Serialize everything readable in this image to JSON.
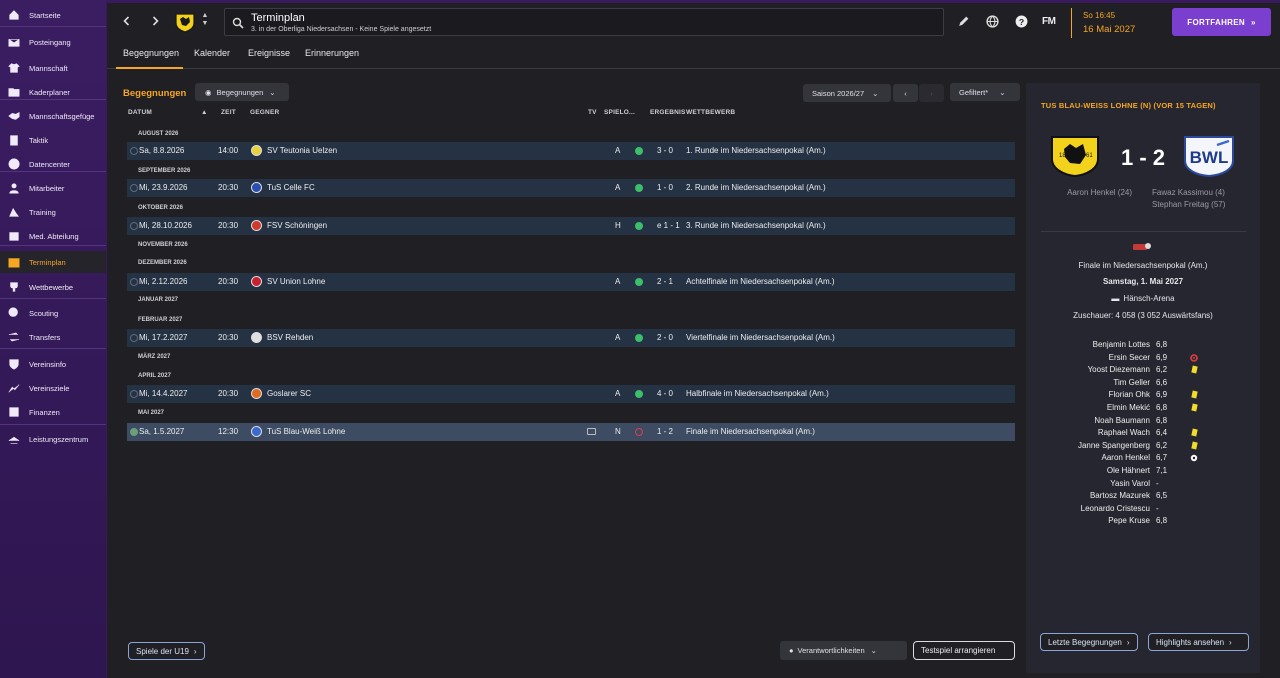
{
  "sidebar": {
    "items": [
      {
        "label": "Startseite",
        "icon": "home-icon"
      },
      {
        "label": "Posteingang",
        "icon": "inbox-icon"
      },
      {
        "label": "Mannschaft",
        "icon": "shirt-icon"
      },
      {
        "label": "Kaderplaner",
        "icon": "folder-icon"
      },
      {
        "label": "Mannschaftsgefüge",
        "icon": "handshake-icon"
      },
      {
        "label": "Taktik",
        "icon": "clipboard-icon"
      },
      {
        "label": "Datencenter",
        "icon": "data-icon"
      },
      {
        "label": "Mitarbeiter",
        "icon": "staff-icon"
      },
      {
        "label": "Training",
        "icon": "training-icon"
      },
      {
        "label": "Med. Abteilung",
        "icon": "medical-icon"
      },
      {
        "label": "Terminplan",
        "icon": "calendar-icon"
      },
      {
        "label": "Wettbewerbe",
        "icon": "trophy-icon"
      },
      {
        "label": "Scouting",
        "icon": "scouting-icon"
      },
      {
        "label": "Transfers",
        "icon": "transfers-icon"
      },
      {
        "label": "Vereinsinfo",
        "icon": "shield-icon"
      },
      {
        "label": "Vereinsziele",
        "icon": "goals-icon"
      },
      {
        "label": "Finanzen",
        "icon": "finance-icon"
      },
      {
        "label": "Leistungszentrum",
        "icon": "academy-icon"
      }
    ],
    "active": "Terminplan"
  },
  "header": {
    "title": "Terminplan",
    "subtitle": "3. in der Oberliga Niedersachsen - Keine Spiele angesetzt",
    "fm_label": "FM",
    "time": "So 16:45",
    "date": "16 Mai 2027",
    "continue_label": "FORTFAHREN"
  },
  "tabs": [
    "Begegnungen",
    "Kalender",
    "Ereignisse",
    "Erinnerungen"
  ],
  "section": {
    "title": "Begegnungen",
    "view_dropdown": "Begegnungen",
    "season": "Saison 2026/27",
    "filter": "Gefiltert*"
  },
  "table": {
    "columns": {
      "date": "DATUM",
      "time": "ZEIT",
      "opponent": "GEGNER",
      "tv": "TV",
      "venue": "SPIELO...",
      "result": "ERGEBNIS",
      "competition": "WETTBEWERB"
    },
    "rows": [
      {
        "type": "month",
        "label": "AUGUST 2026"
      },
      {
        "type": "match",
        "date": "Sa, 8.8.2026",
        "time": "14:00",
        "opponent": "SV Teutonia Uelzen",
        "venue": "A",
        "result": "3 - 0",
        "outcome": "win",
        "competition": "1. Runde im Niedersachsenpokal (Am.)",
        "badge_color": "#e8d23a"
      },
      {
        "type": "month",
        "label": "SEPTEMBER 2026"
      },
      {
        "type": "match",
        "date": "Mi, 23.9.2026",
        "time": "20:30",
        "opponent": "TuS Celle FC",
        "venue": "A",
        "result": "1 - 0",
        "outcome": "win",
        "competition": "2. Runde im Niedersachsenpokal (Am.)",
        "badge_color": "#2a4fb0"
      },
      {
        "type": "month",
        "label": "OKTOBER 2026"
      },
      {
        "type": "match",
        "date": "Mi, 28.10.2026",
        "time": "20:30",
        "opponent": "FSV Schöningen",
        "venue": "H",
        "result": "e 1 - 1",
        "outcome": "win",
        "competition": "3. Runde im Niedersachsenpokal (Am.)",
        "badge_color": "#d03a2a"
      },
      {
        "type": "month",
        "label": "NOVEMBER 2026"
      },
      {
        "type": "month",
        "label": "DEZEMBER 2026"
      },
      {
        "type": "match",
        "date": "Mi, 2.12.2026",
        "time": "20:30",
        "opponent": "SV Union Lohne",
        "venue": "A",
        "result": "2 - 1",
        "outcome": "win",
        "competition": "Achtelfinale im Niedersachsenpokal (Am.)",
        "badge_color": "#c82030"
      },
      {
        "type": "month",
        "label": "JANUAR 2027"
      },
      {
        "type": "month",
        "label": "FEBRUAR 2027"
      },
      {
        "type": "match",
        "date": "Mi, 17.2.2027",
        "time": "20:30",
        "opponent": "BSV Rehden",
        "venue": "A",
        "result": "2 - 0",
        "outcome": "win",
        "competition": "Viertelfinale im Niedersachsenpokal (Am.)",
        "badge_color": "#e0e0e0"
      },
      {
        "type": "month",
        "label": "MÄRZ 2027"
      },
      {
        "type": "month",
        "label": "APRIL 2027"
      },
      {
        "type": "match",
        "date": "Mi, 14.4.2027",
        "time": "20:30",
        "opponent": "Goslarer SC",
        "venue": "A",
        "result": "4 - 0",
        "outcome": "win",
        "competition": "Halbfinale im Niedersachsenpokal (Am.)",
        "badge_color": "#e06a20"
      },
      {
        "type": "month",
        "label": "MAI 2027"
      },
      {
        "type": "match",
        "date": "Sa, 1.5.2027",
        "time": "12:30",
        "opponent": "TuS Blau-Weiß Lohne",
        "venue": "N",
        "result": "1 - 2",
        "outcome": "loss",
        "competition": "Finale im Niedersachsenpokal (Am.)",
        "badge_color": "#3a6ad0",
        "tv": true,
        "selected": true
      }
    ]
  },
  "bottom": {
    "u19_button": "Spiele der U19",
    "responsibilities": "Verantwortlichkeiten",
    "friendly_button": "Testspiel arrangieren"
  },
  "panel": {
    "title": "TUS BLAU-WEISS LOHNE (N) (VOR 15 TAGEN)",
    "score": "1 - 2",
    "home_scorers": [
      "Aaron Henkel (24)"
    ],
    "away_scorers": [
      "Fawaz Kassimou (4)",
      "Stephan Freitag (57)"
    ],
    "competition": "Finale im Niedersachsenpokal (Am.)",
    "date": "Samstag, 1. Mai 2027",
    "stadium": "Hänsch-Arena",
    "attendance": "Zuschauer: 4 058 (3 052 Auswärtsfans)",
    "players": [
      {
        "name": "Benjamin Lottes",
        "rating": "6,8",
        "icon": ""
      },
      {
        "name": "Ersin Secer",
        "rating": "6,9",
        "icon": "red"
      },
      {
        "name": "Yoost Diezemann",
        "rating": "6,2",
        "icon": "yellow"
      },
      {
        "name": "Tim Geller",
        "rating": "6,6",
        "icon": ""
      },
      {
        "name": "Florian Ohk",
        "rating": "6,9",
        "icon": "yellow"
      },
      {
        "name": "Elmin Mekić",
        "rating": "6,8",
        "icon": "yellow"
      },
      {
        "name": "Noah Baumann",
        "rating": "6,8",
        "icon": ""
      },
      {
        "name": "Raphael Wach",
        "rating": "6,4",
        "icon": "yellow"
      },
      {
        "name": "Janne Spangenberg",
        "rating": "6,2",
        "icon": "yellow"
      },
      {
        "name": "Aaron Henkel",
        "rating": "6,7",
        "icon": "ball"
      },
      {
        "name": "Ole Hähnert",
        "rating": "7,1",
        "icon": ""
      },
      {
        "name": "Yasin Varol",
        "rating": "-",
        "icon": ""
      },
      {
        "name": "Bartosz Mazurek",
        "rating": "6,5",
        "icon": ""
      },
      {
        "name": "Leonardo Cristescu",
        "rating": "-",
        "icon": ""
      },
      {
        "name": "Pepe Kruse",
        "rating": "6,8",
        "icon": ""
      }
    ],
    "last_matches_button": "Letzte Begegnungen",
    "highlights_button": "Highlights ansehen"
  }
}
